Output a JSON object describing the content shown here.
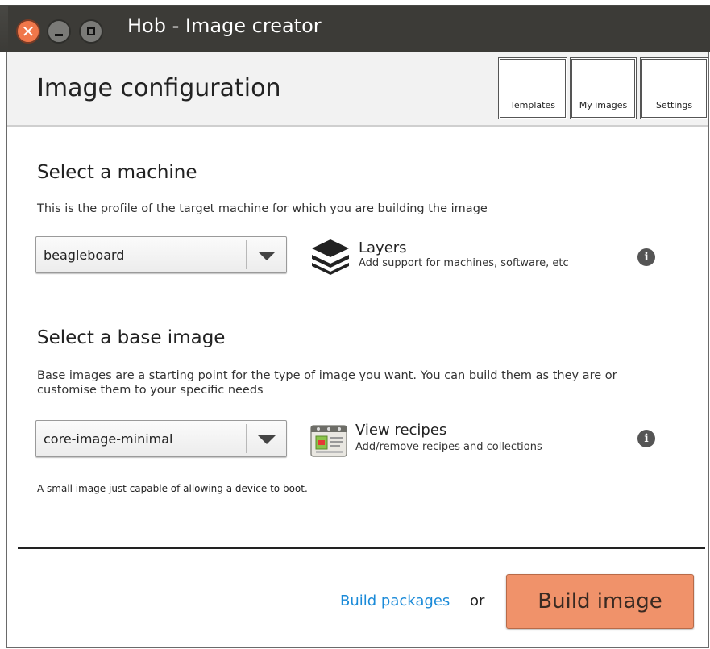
{
  "window": {
    "title": "Hob - Image creator",
    "close_symbol": "✕"
  },
  "header": {
    "title": "Image configuration",
    "buttons": {
      "templates": "Templates",
      "my_images": "My images",
      "settings": "Settings"
    }
  },
  "machine": {
    "title": "Select a machine",
    "description": "This is the profile of the target machine for which you are building the image",
    "selected": "beagleboard",
    "layers_title": "Layers",
    "layers_subtitle": "Add support for machines, software, etc",
    "info_symbol": "i"
  },
  "base_image": {
    "title": "Select a base image",
    "description": "Base images are a starting point for the type of image you want. You can build them as they are or customise them to your specific needs",
    "selected": "core-image-minimal",
    "recipes_title": "View recipes",
    "recipes_subtitle": "Add/remove recipes and collections",
    "info_symbol": "i",
    "note": "A small image just capable of allowing a device to boot."
  },
  "footer": {
    "build_packages": "Build packages",
    "or": "or",
    "build_image": "Build image"
  },
  "colors": {
    "titlebar": "#3c3b37",
    "close_button": "#f0774a",
    "build_button": "#f0926a",
    "link": "#1a8ad8"
  },
  "icons": [
    "close-icon",
    "minimize-icon",
    "maximize-icon",
    "layers-icon",
    "recipes-icon",
    "info-icon",
    "chevron-down-icon"
  ]
}
